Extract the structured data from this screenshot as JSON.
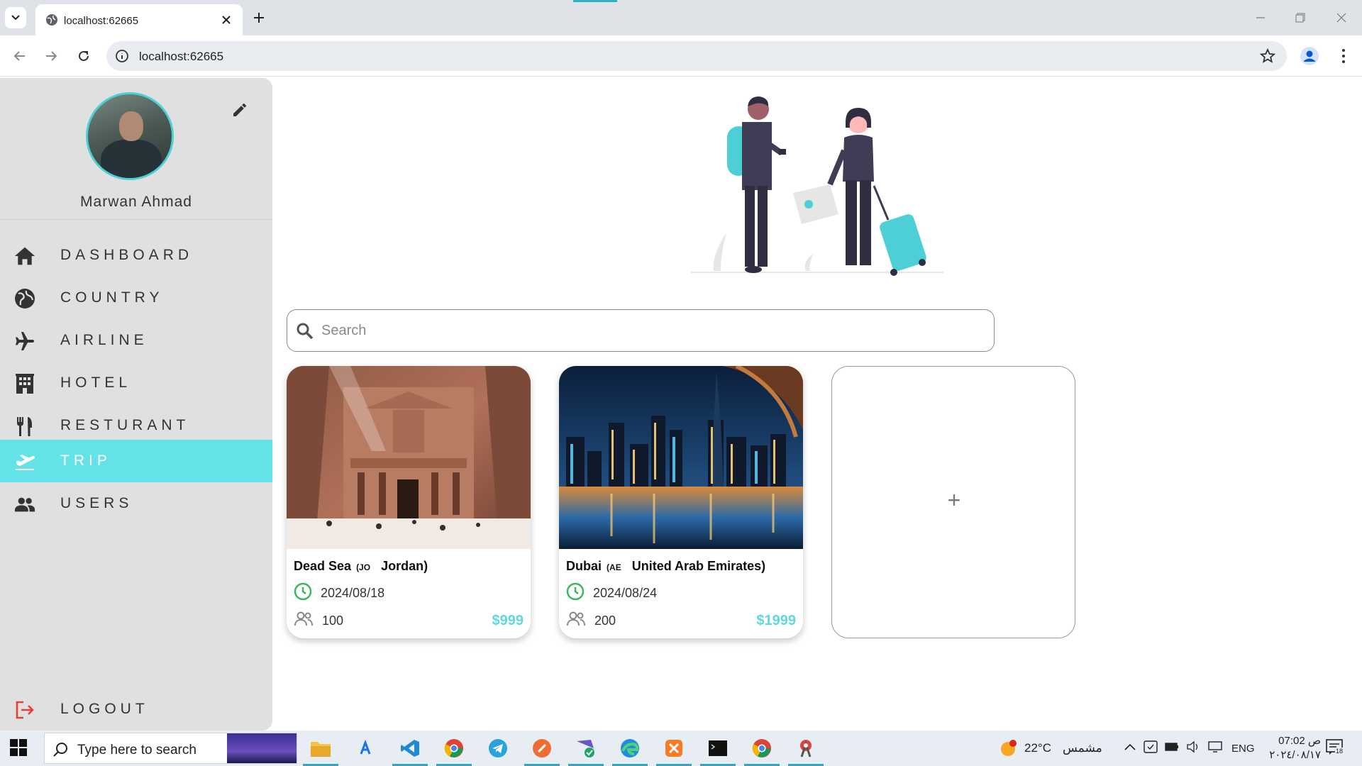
{
  "browser": {
    "tab_title": "localhost:62665",
    "url": "localhost:62665"
  },
  "sidebar": {
    "user_name": "Marwan Ahmad",
    "items": [
      {
        "label": "DASHBOARD",
        "icon": "home-icon"
      },
      {
        "label": "COUNTRY",
        "icon": "globe-icon"
      },
      {
        "label": "AIRLINE",
        "icon": "airplane-icon"
      },
      {
        "label": "HOTEL",
        "icon": "hotel-icon"
      },
      {
        "label": "RESTURANT",
        "icon": "restaurant-icon"
      },
      {
        "label": "TRIP",
        "icon": "flight-takeoff-icon",
        "active": true
      },
      {
        "label": "USERS",
        "icon": "users-icon"
      }
    ],
    "logout_label": "LOGOUT"
  },
  "search": {
    "placeholder": "Search"
  },
  "trips": [
    {
      "city": "Dead Sea",
      "country_code": "(JO",
      "country": "Jordan)",
      "date": "2024/08/18",
      "people": "100",
      "price": "$999"
    },
    {
      "city": "Dubai",
      "country_code": "(AE",
      "country": "United Arab Emirates)",
      "date": "2024/08/24",
      "people": "200",
      "price": "$1999"
    }
  ],
  "add_card": {
    "symbol": "+"
  },
  "taskbar": {
    "search_placeholder": "Type here to search",
    "weather_temp": "22°C",
    "weather_text": "مشمس",
    "language": "ENG",
    "time": "07:02 ص",
    "date": "٢٠٢٤/٠٨/١٧",
    "notification_count": "18"
  },
  "colors": {
    "accent": "#63e3e7",
    "price": "#5ed8de",
    "sidebar_bg": "#e0e0e0",
    "logout_icon": "#e0413a"
  }
}
